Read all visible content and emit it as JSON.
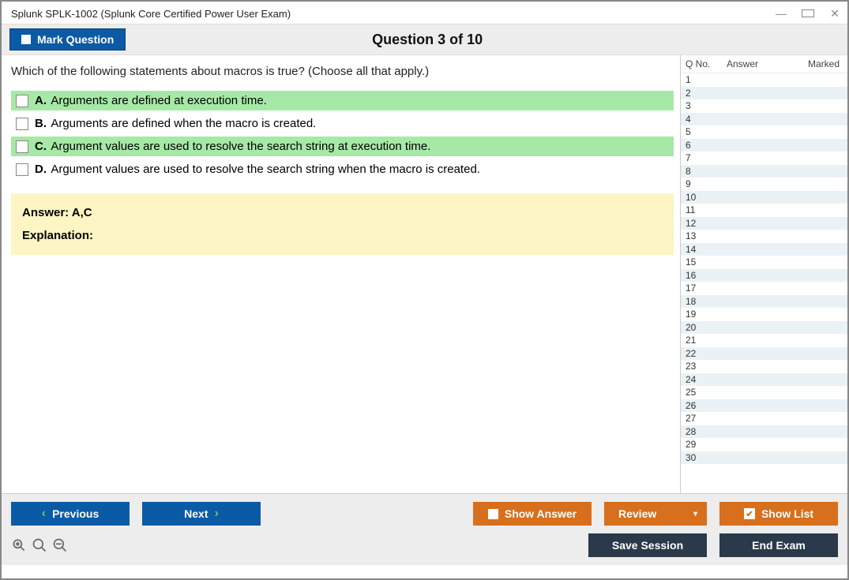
{
  "window": {
    "title": "Splunk SPLK-1002 (Splunk Core Certified Power User Exam)"
  },
  "header": {
    "mark_label": "Mark Question",
    "question_counter": "Question 3 of 10"
  },
  "question": {
    "text": "Which of the following statements about macros is true? (Choose all that apply.)",
    "options": [
      {
        "letter": "A.",
        "text": "Arguments are defined at execution time.",
        "correct": true
      },
      {
        "letter": "B.",
        "text": "Arguments are defined when the macro is created.",
        "correct": false
      },
      {
        "letter": "C.",
        "text": "Argument values are used to resolve the search string at execution time.",
        "correct": true
      },
      {
        "letter": "D.",
        "text": "Argument values are used to resolve the search string when the macro is created.",
        "correct": false
      }
    ]
  },
  "answer_panel": {
    "answer_label": "Answer: A,C",
    "explanation_label": "Explanation:"
  },
  "side_panel": {
    "col_qno": "Q No.",
    "col_answer": "Answer",
    "col_marked": "Marked",
    "rows": [
      {
        "n": "1"
      },
      {
        "n": "2"
      },
      {
        "n": "3"
      },
      {
        "n": "4"
      },
      {
        "n": "5"
      },
      {
        "n": "6"
      },
      {
        "n": "7"
      },
      {
        "n": "8"
      },
      {
        "n": "9"
      },
      {
        "n": "10"
      },
      {
        "n": "11"
      },
      {
        "n": "12"
      },
      {
        "n": "13"
      },
      {
        "n": "14"
      },
      {
        "n": "15"
      },
      {
        "n": "16"
      },
      {
        "n": "17"
      },
      {
        "n": "18"
      },
      {
        "n": "19"
      },
      {
        "n": "20"
      },
      {
        "n": "21"
      },
      {
        "n": "22"
      },
      {
        "n": "23"
      },
      {
        "n": "24"
      },
      {
        "n": "25"
      },
      {
        "n": "26"
      },
      {
        "n": "27"
      },
      {
        "n": "28"
      },
      {
        "n": "29"
      },
      {
        "n": "30"
      }
    ]
  },
  "footer": {
    "previous": "Previous",
    "next": "Next",
    "show_answer": "Show Answer",
    "review": "Review",
    "show_list": "Show List",
    "save_session": "Save Session",
    "end_exam": "End Exam"
  }
}
